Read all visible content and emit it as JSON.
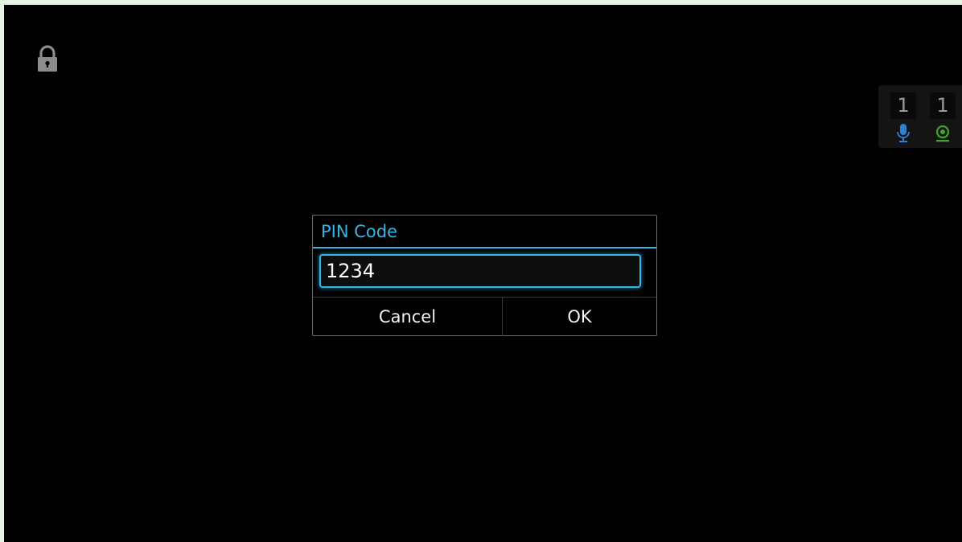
{
  "status": {
    "lock_icon": "lock-icon",
    "mic_count": "1",
    "camera_count": "1",
    "mic_icon": "microphone-icon",
    "camera_icon": "webcam-icon",
    "mic_color": "#2f7fd6",
    "camera_color": "#3fa62a"
  },
  "dialog": {
    "title": "PIN Code",
    "pin_value": "1234",
    "cancel_label": "Cancel",
    "ok_label": "OK",
    "accent_color": "#33b5e5"
  }
}
